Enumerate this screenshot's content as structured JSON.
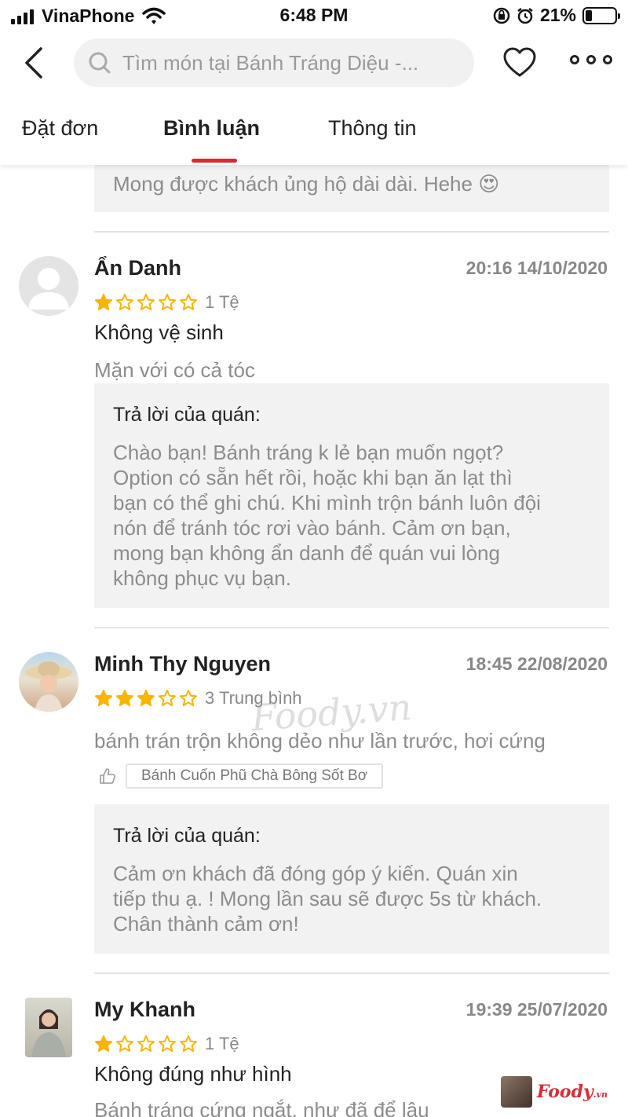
{
  "status_bar": {
    "carrier": "VinaPhone",
    "time": "6:48 PM",
    "battery": "21%",
    "battery_level": 0.21,
    "icons": [
      "signal-icon",
      "wifi-icon",
      "rotation-lock-icon",
      "alarm-icon",
      "battery-icon"
    ]
  },
  "header": {
    "search_placeholder": "Tìm món tại Bánh Tráng Diệu -...",
    "icons": [
      "back-icon",
      "search-icon",
      "heart-icon",
      "more-icon"
    ]
  },
  "tabs": [
    {
      "label": "Đặt đơn",
      "active": false
    },
    {
      "label": "Bình luận",
      "active": true
    },
    {
      "label": "Thông tin",
      "active": false
    }
  ],
  "colors": {
    "accent": "#e0252f",
    "star": "#f7b500",
    "muted": "#8c8c8c",
    "reply_bg": "#f2f2f2"
  },
  "previous_reply_tail": {
    "text": "Mong được khách ủng hộ dài dài. Hehe",
    "emoji": "😍"
  },
  "reviews": [
    {
      "name": "Ẩn Danh",
      "date": "20:16 14/10/2020",
      "rating": 1,
      "rating_label": "1 Tệ",
      "title": "Không vệ sinh",
      "body": "Mặn với có cả tóc",
      "reply_label": "Trả lời của quán:",
      "reply_lines": [
        "Chào bạn! Bánh tráng k lẻ bạn muốn ngọt?",
        "Option có sẵn hết rồi, hoặc khi bạn ăn lạt thì",
        "bạn có thể ghi chú. Khi mình trộn bánh luôn đội",
        "nón để tránh tóc rơi vào bánh. Cảm ơn bạn,",
        "mong bạn không ẩn danh để quán vui lòng",
        "không phục vụ bạn."
      ]
    },
    {
      "name": "Minh Thy Nguyen",
      "date": "18:45 22/08/2020",
      "rating": 3,
      "rating_label": "3 Trung bình",
      "body": "bánh trán trộn không dẻo như lần trước, hơi cứng",
      "liked_dish": "Bánh Cuốn Phũ Chà Bông Sốt Bơ",
      "reply_label": "Trả lời của quán:",
      "reply_lines": [
        "Cảm ơn khách đã đóng góp ý kiến. Quán xin",
        "tiếp thu ạ. ! Mong lần sau sẽ được 5s từ khách.",
        "Chân thành cảm ơn!"
      ]
    },
    {
      "name": "My Khanh",
      "date": "19:39 25/07/2020",
      "rating": 1,
      "rating_label": "1 Tệ",
      "title": "Không đúng như hình",
      "body": "Bánh tráng cứng ngắt, như đã để lâu"
    }
  ],
  "watermark": "Foody.vn",
  "brand_badge": {
    "name": "Foody",
    "suffix": ".vn"
  }
}
